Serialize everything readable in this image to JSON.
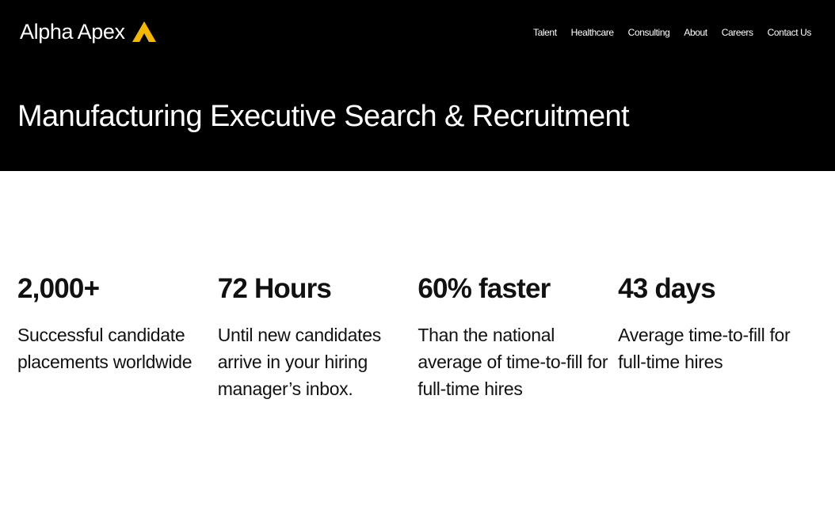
{
  "brand": {
    "name": "Alpha Apex",
    "accent_color": "#F5B800",
    "logo_icon": "triangle-chevron-icon"
  },
  "nav": {
    "items": [
      {
        "label": "Talent"
      },
      {
        "label": "Healthcare"
      },
      {
        "label": "Consulting"
      },
      {
        "label": "About"
      },
      {
        "label": "Careers"
      },
      {
        "label": "Contact Us"
      }
    ]
  },
  "hero": {
    "title": "Manufacturing Executive Search & Recruitment",
    "background": "#000000"
  },
  "stats": [
    {
      "value": "2,000+",
      "description": "Successful candidate placements worldwide"
    },
    {
      "value": "72 Hours",
      "description": "Until new candidates arrive in your hiring manager’s inbox."
    },
    {
      "value": "60% faster",
      "description": "Than the national average of time-to-fill for full-time hires"
    },
    {
      "value": "43 days",
      "description": "Average time-to-fill for full-time hires"
    }
  ]
}
